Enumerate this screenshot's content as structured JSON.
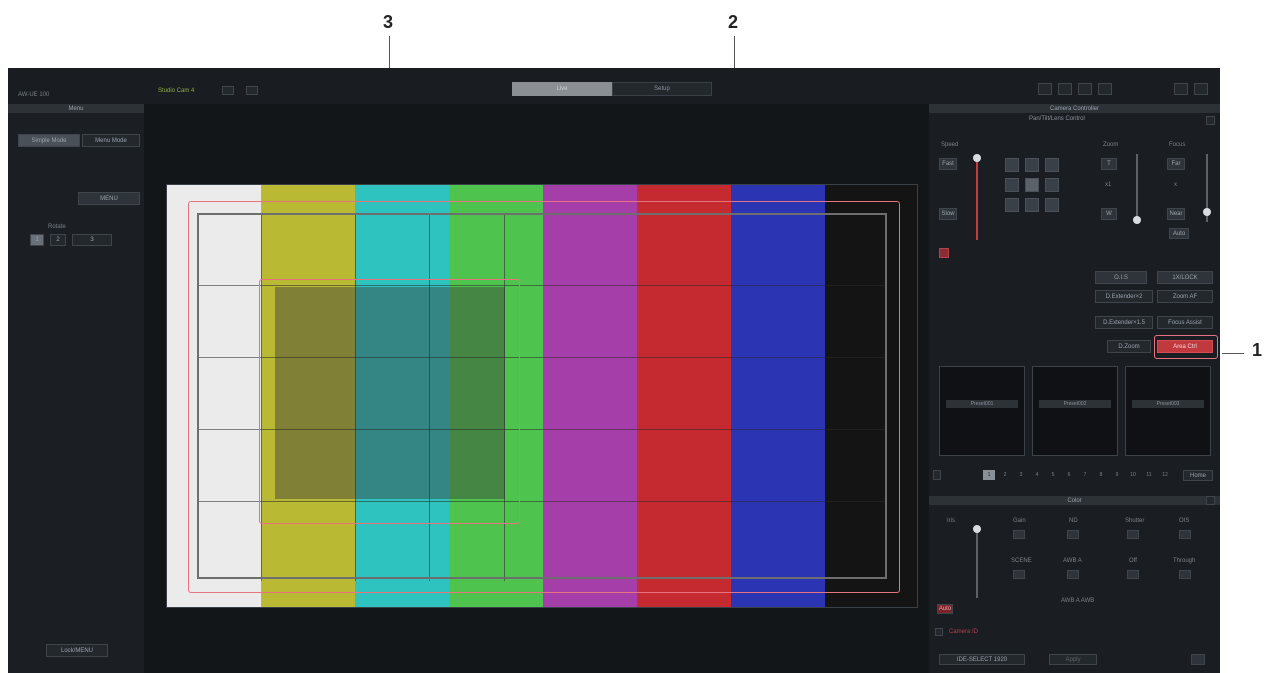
{
  "callouts": {
    "one": "1",
    "two": "2",
    "three": "3"
  },
  "app": {
    "title": "AW-UE 100",
    "camera_name": "Studio Cam 4",
    "tabs": [
      "Live",
      "Setup"
    ],
    "active_tab": "Live"
  },
  "left_panel": {
    "header": "Menu",
    "mode_tabs": [
      "Simple Mode",
      "Menu Mode"
    ],
    "menu_button": "MENU",
    "rotate_label": "Rotate",
    "rotate_values": [
      "1",
      "2",
      "3"
    ],
    "bottom_button": "Lock/MENU"
  },
  "camera_control": {
    "header": "Camera Controller",
    "subheader": "Pan/Tilt/Lens Control",
    "speed_label": "Speed",
    "speed_fast": "Fast",
    "speed_slow": "Slow",
    "zoom_label": "Zoom",
    "zoom_tele": "T",
    "zoom_mid": "x1",
    "zoom_wide": "W",
    "focus_label": "Focus",
    "focus_far": "Far",
    "focus_mid": "x",
    "focus_near": "Near",
    "focus_auto": "Auto",
    "o_is": "O.I.S",
    "lock": "1X/LOCK",
    "d_zoom_x2": "D.Extender×2",
    "d_zoom": "Zoom AF",
    "d_extender": "D.Extender×1.5",
    "focus_assist": "Focus Assist",
    "d_zoom_btn": "D.Zoom",
    "area_ctrl": "Area Ctrl"
  },
  "presets": {
    "items": [
      "Preset001",
      "Preset002",
      "Preset003"
    ],
    "pages": [
      "1",
      "2",
      "3",
      "4",
      "5",
      "6",
      "7",
      "8",
      "9",
      "10",
      "11",
      "12"
    ],
    "home_label": "Home"
  },
  "image_panel": {
    "header": "Color",
    "iris_label": "Iris",
    "auto_label": "Auto",
    "gain_label": "Gain",
    "nd_label": "ND",
    "shutter_label": "Shutter",
    "gamma_label": "OIS",
    "scene_label": "SCENE",
    "awb_a_label": "AWB A",
    "off_label": "Off",
    "through_label": "Through",
    "awb_values": "AWB A  AWB",
    "camera_status": "Camera ID",
    "bottom_text": "IDE-SELECT 1920",
    "bottom_btn": "Apply"
  },
  "colors": {
    "highlight": "#e8737e",
    "bars": [
      "#ebebeb",
      "#b9b934",
      "#2fc3c0",
      "#4ec44e",
      "#a53ea8",
      "#c42a30",
      "#2b35b3",
      "#141414"
    ]
  },
  "icons": [
    "layout-1-icon",
    "layout-2-icon",
    "layout-3-icon",
    "layout-4-icon",
    "fullscreen-icon",
    "settings-icon"
  ]
}
